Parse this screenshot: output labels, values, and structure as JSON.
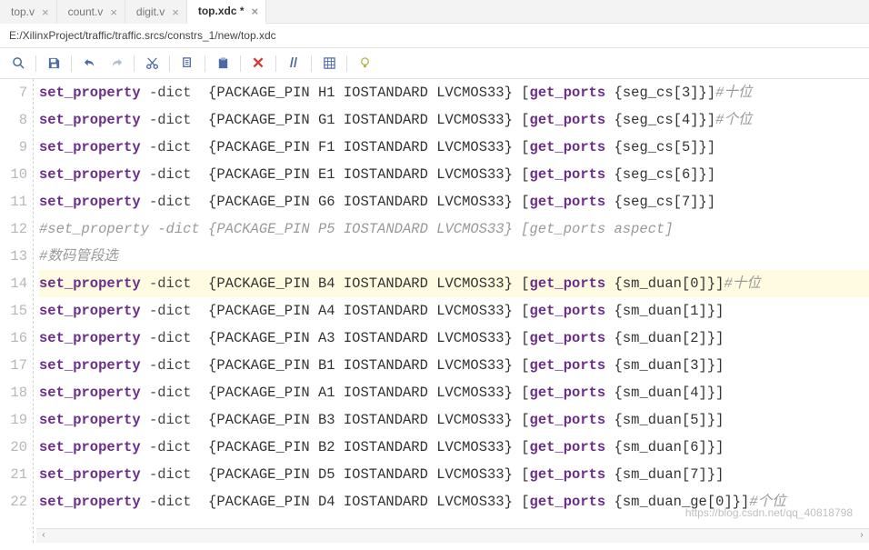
{
  "tabs": [
    {
      "label": "top.v"
    },
    {
      "label": "count.v"
    },
    {
      "label": "digit.v"
    },
    {
      "label": "top.xdc *"
    }
  ],
  "active_tab_index": 3,
  "file_path": "E:/XilinxProject/traffic/traffic.srcs/constrs_1/new/top.xdc",
  "toolbar": {
    "find": "find",
    "save": "save",
    "undo": "undo",
    "redo": "redo",
    "cut": "cut",
    "copy": "copy",
    "paste": "paste",
    "delete": "delete",
    "comment": "comment",
    "columns": "columns",
    "hint": "hint"
  },
  "first_line_number": 7,
  "highlight_line_number": 14,
  "lines": [
    {
      "n": 7,
      "type": "set",
      "pin": "H1",
      "port": "seg_cs[3]",
      "comment": "#十位"
    },
    {
      "n": 8,
      "type": "set",
      "pin": "G1",
      "port": "seg_cs[4]",
      "comment": "#个位"
    },
    {
      "n": 9,
      "type": "set",
      "pin": "F1",
      "port": "seg_cs[5]"
    },
    {
      "n": 10,
      "type": "set",
      "pin": "E1",
      "port": "seg_cs[6]"
    },
    {
      "n": 11,
      "type": "set",
      "pin": "G6",
      "port": "seg_cs[7]"
    },
    {
      "n": 12,
      "type": "comment",
      "text": "#set_property -dict {PACKAGE_PIN P5 IOSTANDARD LVCMOS33} [get_ports aspect]"
    },
    {
      "n": 13,
      "type": "comment",
      "text": "#数码管段选"
    },
    {
      "n": 14,
      "type": "set",
      "pin": "B4",
      "port": "sm_duan[0]",
      "comment": "#十位"
    },
    {
      "n": 15,
      "type": "set",
      "pin": "A4",
      "port": "sm_duan[1]"
    },
    {
      "n": 16,
      "type": "set",
      "pin": "A3",
      "port": "sm_duan[2]"
    },
    {
      "n": 17,
      "type": "set",
      "pin": "B1",
      "port": "sm_duan[3]"
    },
    {
      "n": 18,
      "type": "set",
      "pin": "A1",
      "port": "sm_duan[4]"
    },
    {
      "n": 19,
      "type": "set",
      "pin": "B3",
      "port": "sm_duan[5]"
    },
    {
      "n": 20,
      "type": "set",
      "pin": "B2",
      "port": "sm_duan[6]"
    },
    {
      "n": 21,
      "type": "set",
      "pin": "D5",
      "port": "sm_duan[7]"
    },
    {
      "n": 22,
      "type": "set",
      "pin": "D4",
      "port": "sm_duan_ge[0]",
      "comment": "#个位"
    }
  ],
  "tokens": {
    "set_property": "set_property",
    "dict": "-dict",
    "pkg": "PACKAGE_PIN",
    "iostd": "IOSTANDARD LVCMOS33",
    "get_ports": "get_ports"
  },
  "watermark": "https://blog.csdn.net/qq_40818798"
}
